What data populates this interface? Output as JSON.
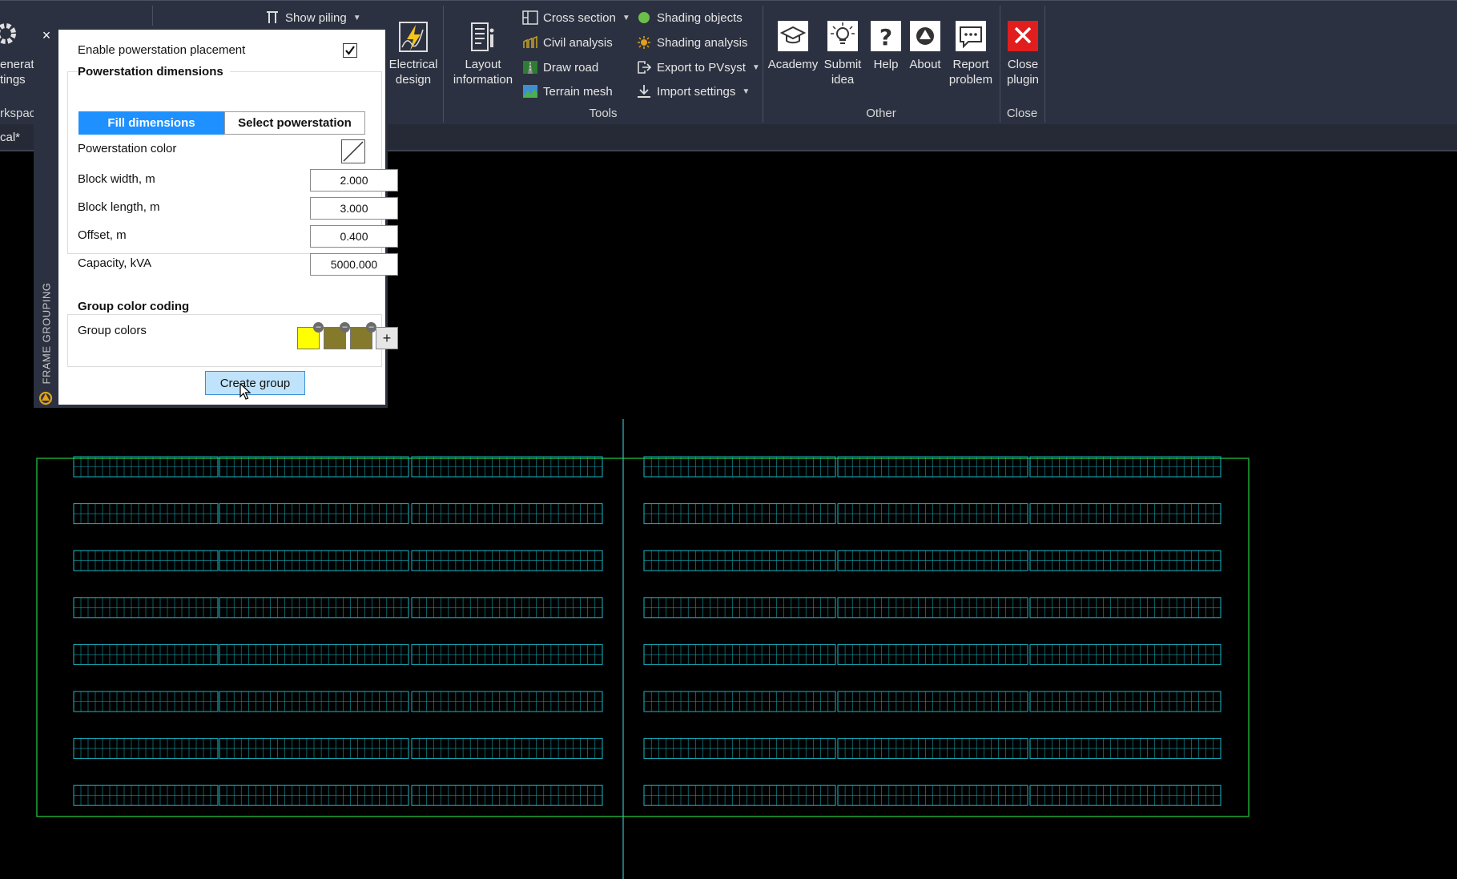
{
  "ribbon": {
    "left_cut": {
      "line1": "enerat",
      "line2": "tings",
      "workspace": "rkspac"
    },
    "tab_label": "cal*",
    "show_piling": "Show piling",
    "electrical": {
      "line1": "Electrical",
      "line2": "design"
    },
    "layout_info": {
      "line1": "Layout",
      "line2": "information"
    },
    "tools": {
      "title": "Tools",
      "cross_section": "Cross section",
      "civil_analysis": "Civil analysis",
      "draw_road": "Draw road",
      "terrain_mesh": "Terrain mesh",
      "shading_objects": "Shading objects",
      "shading_analysis": "Shading analysis",
      "export_pvsyst": "Export to PVsyst",
      "import_settings": "Import settings"
    },
    "other": {
      "title": "Other",
      "academy": "Academy",
      "submit": {
        "line1": "Submit",
        "line2": "idea"
      },
      "help": "Help",
      "about": "About",
      "report": {
        "line1": "Report",
        "line2": "problem"
      }
    },
    "close": {
      "title": "Close",
      "line1": "Close",
      "line2": "plugin"
    }
  },
  "palette": {
    "vertical_title": "FRAME GROUPING",
    "close_glyph": "×",
    "enable_label": "Enable powerstation placement",
    "enable_checked": true,
    "dims_title": "Powerstation dimensions",
    "seg_fill": "Fill dimensions",
    "seg_select": "Select powerstation",
    "color_label": "Powerstation color",
    "block_width_label": "Block width, m",
    "block_width_value": "2.000",
    "block_length_label": "Block length, m",
    "block_length_value": "3.000",
    "offset_label": "Offset, m",
    "offset_value": "0.400",
    "capacity_label": "Capacity, kVA",
    "capacity_value": "5000.000",
    "color_coding_title": "Group color coding",
    "group_colors_label": "Group colors",
    "group_colors": [
      "#ffff00",
      "#857a2c",
      "#857a2c"
    ],
    "add_glyph": "+",
    "create_button": "Create group"
  },
  "canvas": {
    "colors": {
      "rows": "#19b7c6",
      "boundary": "#1aa832",
      "axis": "#3fb6c6"
    }
  }
}
